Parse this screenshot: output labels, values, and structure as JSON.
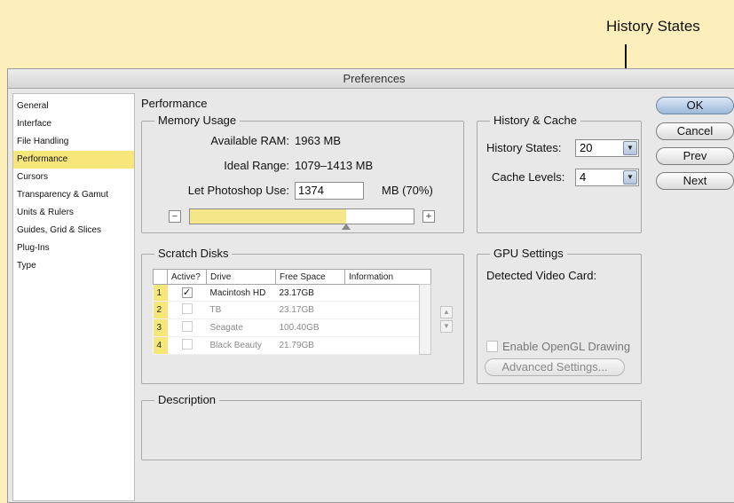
{
  "callout": {
    "label": "History States"
  },
  "window": {
    "title": "Preferences"
  },
  "sidebar": {
    "items": [
      {
        "label": "General",
        "selected": false
      },
      {
        "label": "Interface",
        "selected": false
      },
      {
        "label": "File Handling",
        "selected": false
      },
      {
        "label": "Performance",
        "selected": true
      },
      {
        "label": "Cursors",
        "selected": false
      },
      {
        "label": "Transparency & Gamut",
        "selected": false
      },
      {
        "label": "Units & Rulers",
        "selected": false
      },
      {
        "label": "Guides, Grid & Slices",
        "selected": false
      },
      {
        "label": "Plug-Ins",
        "selected": false
      },
      {
        "label": "Type",
        "selected": false
      }
    ]
  },
  "page": {
    "title": "Performance"
  },
  "memory": {
    "title": "Memory Usage",
    "available_label": "Available RAM:",
    "available_value": "1963 MB",
    "ideal_label": "Ideal Range:",
    "ideal_value": "1079–1413 MB",
    "use_label": "Let Photoshop Use:",
    "use_value": "1374",
    "use_unit": "MB (70%)",
    "slider_fraction": 0.7,
    "minus": "−",
    "plus": "+"
  },
  "history": {
    "title": "History & Cache",
    "states_label": "History States:",
    "states_value": "20",
    "cache_label": "Cache Levels:",
    "cache_value": "4"
  },
  "buttons": {
    "ok": "OK",
    "cancel": "Cancel",
    "prev": "Prev",
    "next": "Next"
  },
  "scratch": {
    "title": "Scratch Disks",
    "columns": [
      "Active?",
      "Drive",
      "Free Space",
      "Information"
    ],
    "rows": [
      {
        "num": "1",
        "active": true,
        "drive": "Macintosh HD",
        "free": "23.17GB",
        "info": ""
      },
      {
        "num": "2",
        "active": false,
        "drive": "TB",
        "free": "23.17GB",
        "info": ""
      },
      {
        "num": "3",
        "active": false,
        "drive": "Seagate",
        "free": "100.40GB",
        "info": ""
      },
      {
        "num": "4",
        "active": false,
        "drive": "Black Beauty",
        "free": "21.79GB",
        "info": ""
      }
    ],
    "up_arrow": "▲",
    "down_arrow": "▼"
  },
  "gpu": {
    "title": "GPU Settings",
    "detected_label": "Detected Video Card:",
    "opengl_label": "Enable OpenGL Drawing",
    "advanced_label": "Advanced Settings..."
  },
  "description": {
    "title": "Description"
  },
  "icons": {
    "dropdown": "▼",
    "checkmark": "✓"
  }
}
